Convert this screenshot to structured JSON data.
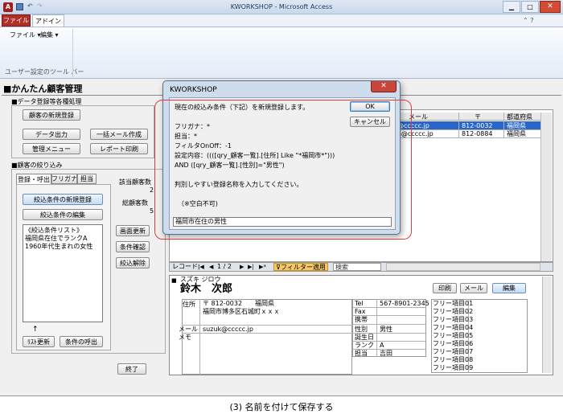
{
  "titlebar": {
    "title": "KWORKSHOP - Microsoft Access"
  },
  "ribbon": {
    "tab_file": "ファイル",
    "tab_addin": "アドイン",
    "menu_file": "ファイル",
    "menu_edit": "編集",
    "group_label": "ユーザー設定のツール バー"
  },
  "form": {
    "title": "■かんたん顧客管理",
    "section1": "■データ登録等各種処理",
    "btn_new_customer": "顧客の新規登録",
    "btn_data_out": "データ出力",
    "btn_bulk_mail": "一括メール作成",
    "btn_admin_menu": "管理メニュー",
    "btn_report": "レポート印刷",
    "section2": "■顧客の絞り込み",
    "tabs": [
      "登録・呼出",
      "フリガナ",
      "担当"
    ],
    "btn_register_cond": "絞込条件の新規登録",
    "btn_edit_cond": "絞込条件の編集",
    "cond_list_label": "《絞込条件リスト》",
    "cond_items": [
      "福岡県在住でランクA",
      "1960年代生まれの女性"
    ],
    "arrow": "↑",
    "btn_list_update": "ﾘｽﾄ更新",
    "btn_call_cond": "条件の呼出",
    "label_hits": "該当顧客数",
    "hits_value": "2",
    "label_total": "総顧客数",
    "total_value": "5",
    "btn_screen_update": "画面更新",
    "btn_cond_check": "条件確認",
    "btn_cond_clear": "絞込解除",
    "btn_close": "終了"
  },
  "grid": {
    "headers": [
      "メール",
      "〒",
      "都道府県"
    ],
    "rows": [
      {
        "mail": "@ccccc.jp",
        "zip": "812-0032",
        "pref": "福岡県"
      },
      {
        "mail": "a@ccccc.jp",
        "zip": "812-0884",
        "pref": "福岡県"
      }
    ]
  },
  "navbar": {
    "record_label": "レコード:",
    "first": "|◀",
    "prev": "◀",
    "position": "1 / 2",
    "next": "▶",
    "last": "▶|",
    "new": "▶*",
    "filter": "フィルター適用",
    "search": "検索"
  },
  "detail": {
    "kana": "スズキ ジロウ",
    "name": "鈴木　次郎",
    "btn_print": "印刷",
    "btn_mail": "メール",
    "btn_edit": "編集",
    "addr_label": "住所",
    "addr_line1": "〒 812-0032　　福岡県",
    "addr_line2": "福岡市博多区石城町ｘｘｘ",
    "tel_label": "Tel",
    "tel": "567-8901-2345",
    "fax_label": "Fax",
    "mobile_label": "携帯",
    "mail_label": "メール",
    "mail": "suzuk@ccccc.jp",
    "memo_label": "メモ",
    "gender_label": "性別",
    "gender": "男性",
    "birthday_label": "誕生日",
    "rank_label": "ランク",
    "rank": "A",
    "staff_label": "担当",
    "staff": "吉田",
    "free_items": [
      "フリー項目01",
      "フリー項目02",
      "フリー項目03",
      "フリー項目04",
      "フリー項目05",
      "フリー項目06",
      "フリー項目07",
      "フリー項目08",
      "フリー項目09"
    ]
  },
  "dialog": {
    "title": "KWORKSHOP",
    "line1": "現在の絞込み条件（下記）を新規登録します。",
    "line2": "フリガナ：*",
    "line3": "担当：*",
    "line4": "フィルタOnOff：-1",
    "line5": "設定内容：((([qry_顧客一覧].[住所] Like \"*福岡市*\")))",
    "line6": "AND ([qry_顧客一覧].[性別]=\"男性\")",
    "line7": "判別しやすい登録名称を入力してください。",
    "line8": "（※空白不可)",
    "input_value": "福岡市在住の男性",
    "ok": "OK",
    "cancel": "キャンセル"
  },
  "caption": "(3) 名前を付けて保存する"
}
